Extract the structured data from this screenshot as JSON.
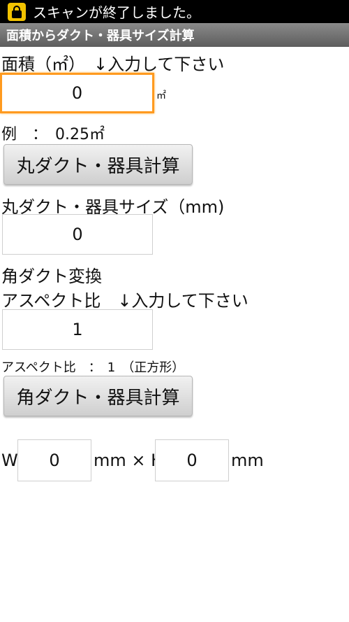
{
  "status_bar": {
    "message": "スキャンが終了しました。"
  },
  "title_bar": {
    "title": "面積からダクト・器具サイズ計算"
  },
  "area": {
    "label": "面積（㎡）　↓入力して下さい",
    "value": "0",
    "unit": "㎡",
    "example": "例　：　0.25㎡"
  },
  "round_button": {
    "label": "丸ダクト・器具計算"
  },
  "round_size": {
    "label": "丸ダクト・器具サイズ（mm)",
    "value": "0"
  },
  "square": {
    "heading": "角ダクト変換",
    "aspect_label": "アスペクト比　↓入力して下さい",
    "aspect_value": "1",
    "aspect_note": "アスペクト比　：　1　（正方形）"
  },
  "square_button": {
    "label": "角ダクト・器具計算"
  },
  "result": {
    "w_label": "W",
    "w_value": "0",
    "mid_label": "mm × H",
    "h_value": "0",
    "end_unit": "mm"
  }
}
